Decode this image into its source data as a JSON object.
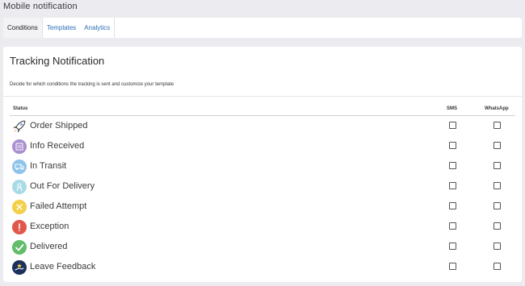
{
  "page": {
    "title": "Mobile notification"
  },
  "tabs": [
    {
      "label": "Conditions",
      "active": true
    },
    {
      "label": "Templates",
      "active": false
    },
    {
      "label": "Analytics",
      "active": false
    }
  ],
  "card": {
    "title": "Tracking Notification",
    "description": "Decide for which conditions the tracking is sent and customize your template"
  },
  "table": {
    "headers": {
      "status": "Status",
      "sms": "SMS",
      "whatsapp": "WhatsApp"
    },
    "rows": [
      {
        "label": "Order Shipped",
        "icon": "rocket-icon",
        "color": "#ffffff",
        "sms": false,
        "whatsapp": false
      },
      {
        "label": "Info Received",
        "icon": "info-received-icon",
        "color": "#a98fcf",
        "sms": false,
        "whatsapp": false
      },
      {
        "label": "In Transit",
        "icon": "in-transit-icon",
        "color": "#8ec3ea",
        "sms": false,
        "whatsapp": false
      },
      {
        "label": "Out For Delivery",
        "icon": "out-for-delivery-icon",
        "color": "#a9dbe6",
        "sms": false,
        "whatsapp": false
      },
      {
        "label": "Failed Attempt",
        "icon": "failed-attempt-icon",
        "color": "#f4cf4a",
        "sms": false,
        "whatsapp": false
      },
      {
        "label": "Exception",
        "icon": "exception-icon",
        "color": "#e2574c",
        "sms": false,
        "whatsapp": false
      },
      {
        "label": "Delivered",
        "icon": "delivered-icon",
        "color": "#62bd6a",
        "sms": false,
        "whatsapp": false
      },
      {
        "label": "Leave Feedback",
        "icon": "feedback-icon",
        "color": "#1d2f5e",
        "sms": false,
        "whatsapp": false
      }
    ]
  }
}
